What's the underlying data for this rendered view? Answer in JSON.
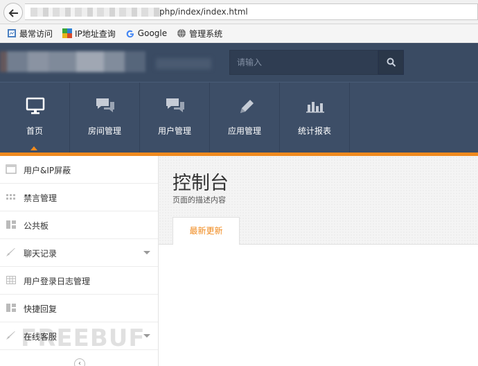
{
  "browser": {
    "url_visible": "php/index/index.html",
    "bookmarks": [
      {
        "label": "最常访问",
        "icon": "bookmark-page-icon"
      },
      {
        "label": "IP地址查询",
        "icon": "puzzle-icon"
      },
      {
        "label": "Google",
        "icon": "google-icon"
      },
      {
        "label": "管理系统",
        "icon": "globe-icon"
      }
    ]
  },
  "header": {
    "search_placeholder": "请输入"
  },
  "nav": {
    "items": [
      {
        "label": "首页",
        "icon": "monitor-icon",
        "active": true
      },
      {
        "label": "房间管理",
        "icon": "chat-bubbles-icon"
      },
      {
        "label": "用户管理",
        "icon": "chat-bubbles-icon"
      },
      {
        "label": "应用管理",
        "icon": "pencil-icon"
      },
      {
        "label": "统计报表",
        "icon": "bar-chart-icon"
      }
    ]
  },
  "sidebar": {
    "items": [
      {
        "label": "用户&IP屏蔽",
        "icon": "window-icon",
        "has_submenu": false
      },
      {
        "label": "禁言管理",
        "icon": "grid-dots-icon",
        "has_submenu": false
      },
      {
        "label": "公共板",
        "icon": "layout-icon",
        "has_submenu": false
      },
      {
        "label": "聊天记录",
        "icon": "brush-icon",
        "has_submenu": true
      },
      {
        "label": "用户登录日志管理",
        "icon": "table-icon",
        "has_submenu": false
      },
      {
        "label": "快捷回复",
        "icon": "layout-icon",
        "has_submenu": false
      },
      {
        "label": "在线客服",
        "icon": "brush-icon",
        "has_submenu": true
      }
    ],
    "collapse_glyph": "‹"
  },
  "main": {
    "title": "控制台",
    "description": "页面的描述内容",
    "tab_active": "最新更新"
  },
  "watermark": "FREEBUF",
  "colors": {
    "accent": "#f08a1e",
    "header_bg": "#3a4b63",
    "nav_bg": "#3d4e67"
  }
}
